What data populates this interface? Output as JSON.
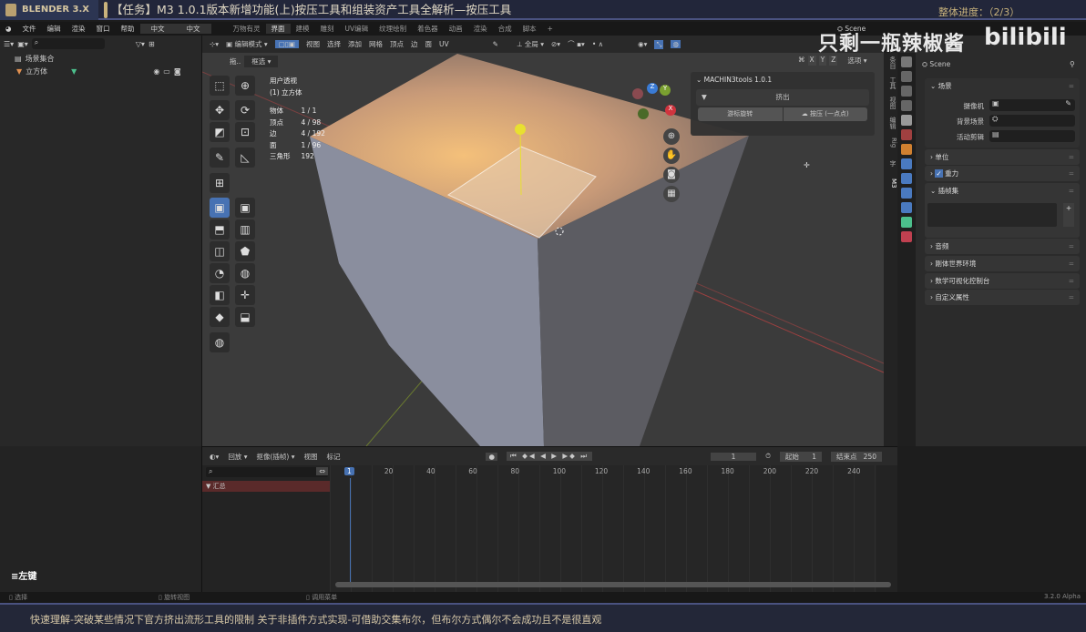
{
  "banner": {
    "brand": "BLENDER 3.X",
    "title": "【任务】M3 1.0.1版本新增功能(上)按压工具和组装资产工具全解析—按压工具",
    "progress": "整体进度：（2/3）"
  },
  "menu": {
    "items": [
      "文件",
      "编辑",
      "渲染",
      "窗口",
      "帮助"
    ],
    "lang": [
      "中文",
      "中文"
    ],
    "workspaces": [
      "万物有灵",
      "界面",
      "建模",
      "雕刻",
      "UV编辑",
      "纹理绘制",
      "着色器",
      "动画",
      "渲染",
      "合成",
      "脚本",
      "+"
    ],
    "scene": "Scene"
  },
  "watermark": {
    "text": "只剩一瓶辣椒酱",
    "logo": "bilibili"
  },
  "outliner": {
    "collection": "场景集合",
    "object": "立方体"
  },
  "viewport": {
    "mode": "编辑模式",
    "menus": [
      "视图",
      "选择",
      "添加",
      "网格",
      "顶点",
      "边",
      "面",
      "UV"
    ],
    "orientation": "全局",
    "drag_label": "拖..",
    "drag_value": "框选",
    "options": "选项",
    "axes": [
      "X",
      "Y",
      "Z"
    ],
    "view_name": "用户透视",
    "object_name": "(1) 立方体",
    "stats": [
      {
        "k": "物体",
        "v": "1 / 1"
      },
      {
        "k": "顶点",
        "v": "4 / 98"
      },
      {
        "k": "边",
        "v": "4 / 192"
      },
      {
        "k": "面",
        "v": "1 / 96"
      },
      {
        "k": "三角形",
        "v": "192"
      }
    ],
    "gizmo": {
      "x": "X",
      "y": "Y",
      "z": "Z"
    }
  },
  "m3panel": {
    "title": "MACHIN3tools 1.0.1",
    "section": "挤出",
    "btn1": "游标旋转",
    "btn2": "按压 (一点点)"
  },
  "ntabs": [
    "条目",
    "工具",
    "视图",
    "编辑",
    "Rig",
    "字",
    "M3"
  ],
  "properties": {
    "scene": "Scene",
    "sections": [
      {
        "label": "场景",
        "fields": [
          {
            "label": "摄像机"
          },
          {
            "label": "背景场景"
          },
          {
            "label": "活动剪辑"
          }
        ]
      }
    ],
    "collapsed": [
      "单位",
      "重力",
      "插帧集",
      "音频",
      "刚体世界环境",
      "数学可视化控制台",
      "自定义属性"
    ]
  },
  "timeline": {
    "menus": [
      "回放",
      "抠像(插帧)",
      "视图",
      "标记"
    ],
    "current": "1",
    "start_label": "起始",
    "start": "1",
    "end_label": "结束点",
    "end": "250",
    "summary": "汇总",
    "ticks": [
      "1",
      "20",
      "40",
      "60",
      "80",
      "100",
      "120",
      "140",
      "160",
      "180",
      "200",
      "220",
      "240"
    ]
  },
  "leftpanel": {
    "key": "≡左键"
  },
  "status": {
    "select": "选择",
    "rotate": "旋转视图",
    "menu": "调用菜单",
    "version": "3.2.0 Alpha"
  },
  "subtitle": "快速理解-突破某些情况下官方挤出流形工具的限制 关于非插件方式实现-可借助交集布尔，但布尔方式偶尔不会成功且不是很直观"
}
